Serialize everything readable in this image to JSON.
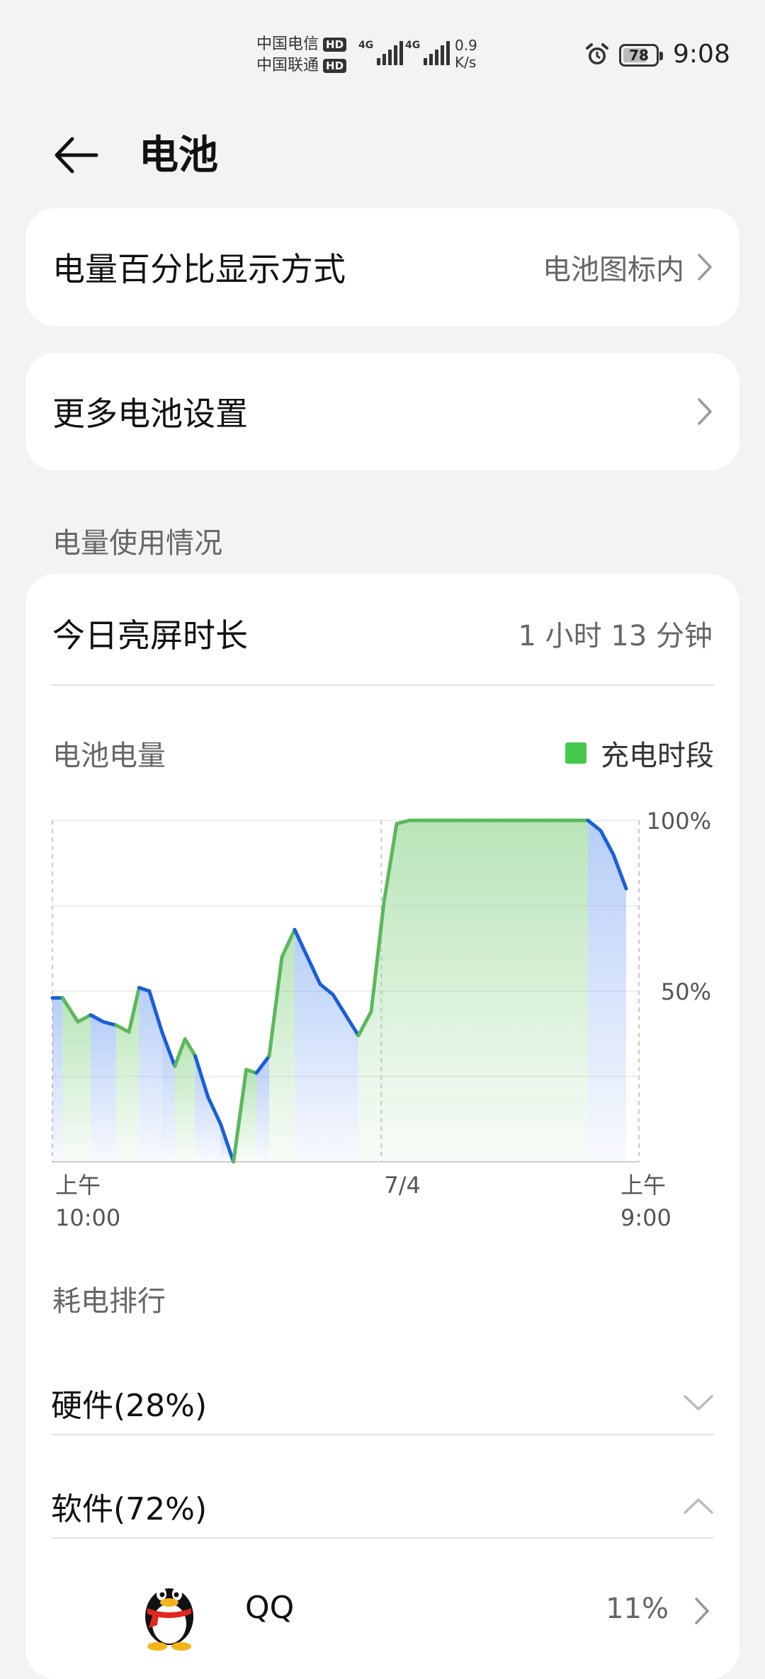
{
  "status": {
    "carrier1": "中国电信",
    "carrier2": "中国联通",
    "hd": "HD",
    "net1": "4G",
    "net2": "4G",
    "speed_value": "0.9",
    "speed_unit": "K/s",
    "battery_level": 78,
    "battery_text": "78",
    "time": "9:08"
  },
  "header": {
    "title": "电池"
  },
  "settings": {
    "percentage_label": "电量百分比显示方式",
    "percentage_value": "电池图标内",
    "more_label": "更多电池设置"
  },
  "usage": {
    "section_label": "电量使用情况",
    "screen_time_label": "今日亮屏时长",
    "screen_time_value": "1 小时 13 分钟",
    "chart_title": "电池电量",
    "legend_label": "充电时段"
  },
  "chart_data": {
    "type": "line",
    "ylabel_ticks": [
      "100%",
      "50%"
    ],
    "ylim": [
      0,
      100
    ],
    "x_ticks": [
      {
        "line1": "上午",
        "line2": "10:00"
      },
      {
        "line1": "7/4",
        "line2": ""
      },
      {
        "line1": "上午",
        "line2": "9:00"
      }
    ],
    "x_range": [
      0,
      23
    ],
    "colors": {
      "discharging": "#1a5fd8",
      "charging": "#5bb85b"
    },
    "points": [
      {
        "x": 0.0,
        "y": 48
      },
      {
        "x": 0.4,
        "y": 48
      },
      {
        "x": 1.0,
        "y": 41
      },
      {
        "x": 1.5,
        "y": 43
      },
      {
        "x": 2.0,
        "y": 41
      },
      {
        "x": 2.5,
        "y": 40
      },
      {
        "x": 3.0,
        "y": 38
      },
      {
        "x": 3.4,
        "y": 51
      },
      {
        "x": 3.8,
        "y": 50
      },
      {
        "x": 4.3,
        "y": 38
      },
      {
        "x": 4.8,
        "y": 28
      },
      {
        "x": 5.2,
        "y": 36
      },
      {
        "x": 5.6,
        "y": 31
      },
      {
        "x": 6.1,
        "y": 19
      },
      {
        "x": 6.6,
        "y": 11
      },
      {
        "x": 7.1,
        "y": 0
      },
      {
        "x": 7.6,
        "y": 27
      },
      {
        "x": 8.0,
        "y": 26
      },
      {
        "x": 8.5,
        "y": 31
      },
      {
        "x": 9.0,
        "y": 60
      },
      {
        "x": 9.5,
        "y": 68
      },
      {
        "x": 10.0,
        "y": 60
      },
      {
        "x": 10.5,
        "y": 52
      },
      {
        "x": 11.0,
        "y": 49
      },
      {
        "x": 12.0,
        "y": 37
      },
      {
        "x": 12.5,
        "y": 44
      },
      {
        "x": 13.0,
        "y": 76
      },
      {
        "x": 13.5,
        "y": 99
      },
      {
        "x": 14.0,
        "y": 100
      },
      {
        "x": 21.0,
        "y": 100
      },
      {
        "x": 21.5,
        "y": 97
      },
      {
        "x": 22.0,
        "y": 90
      },
      {
        "x": 22.5,
        "y": 80
      }
    ],
    "segments": [
      {
        "from": 0.0,
        "to": 0.4,
        "state": "discharging"
      },
      {
        "from": 0.4,
        "to": 1.5,
        "state": "charging"
      },
      {
        "from": 1.5,
        "to": 2.5,
        "state": "discharging"
      },
      {
        "from": 2.5,
        "to": 3.4,
        "state": "charging"
      },
      {
        "from": 3.4,
        "to": 3.8,
        "state": "discharging"
      },
      {
        "from": 3.8,
        "to": 4.3,
        "state": "discharging"
      },
      {
        "from": 4.3,
        "to": 4.8,
        "state": "discharging"
      },
      {
        "from": 4.8,
        "to": 5.6,
        "state": "charging"
      },
      {
        "from": 5.6,
        "to": 6.6,
        "state": "discharging"
      },
      {
        "from": 6.6,
        "to": 7.1,
        "state": "discharging"
      },
      {
        "from": 7.1,
        "to": 8.0,
        "state": "charging"
      },
      {
        "from": 8.0,
        "to": 8.5,
        "state": "discharging"
      },
      {
        "from": 8.5,
        "to": 9.5,
        "state": "charging"
      },
      {
        "from": 9.5,
        "to": 12.0,
        "state": "discharging"
      },
      {
        "from": 12.0,
        "to": 21.0,
        "state": "charging"
      },
      {
        "from": 21.0,
        "to": 22.5,
        "state": "discharging"
      }
    ]
  },
  "ranking": {
    "label": "耗电排行",
    "hardware_label": "硬件(28%)",
    "software_label": "软件(72%)",
    "apps": [
      {
        "name": "QQ",
        "percent": "11%"
      }
    ]
  }
}
